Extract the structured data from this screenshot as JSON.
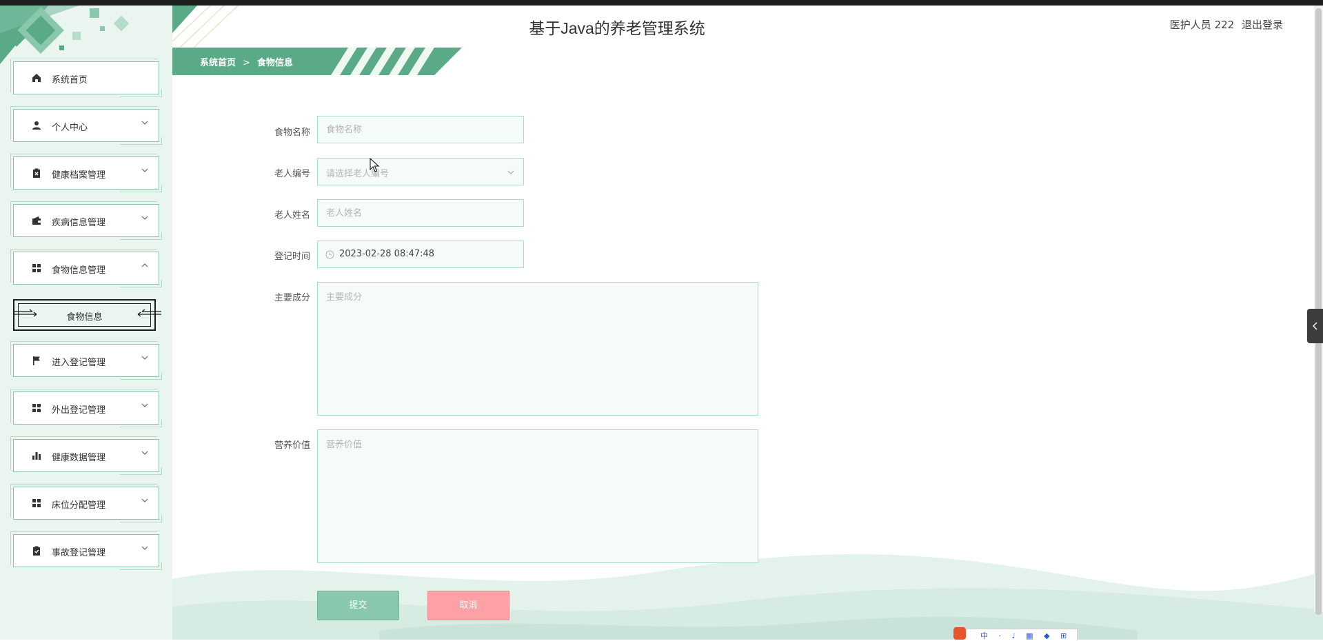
{
  "app": {
    "title": "基于Java的养老管理系统"
  },
  "user": {
    "role_name": "医护人员 222",
    "logout_label": "退出登录"
  },
  "breadcrumb": {
    "home": "系统首页",
    "separator": ">",
    "current": "食物信息"
  },
  "sidebar": {
    "items": [
      {
        "label": "系统首页",
        "icon": "home-icon"
      },
      {
        "label": "个人中心",
        "icon": "person-icon",
        "expandable": true
      },
      {
        "label": "健康档案管理",
        "icon": "clipboard-x-icon",
        "expandable": true
      },
      {
        "label": "疾病信息管理",
        "icon": "wallet-icon",
        "expandable": true
      },
      {
        "label": "食物信息管理",
        "icon": "grid-icon",
        "expandable": true,
        "expanded": true
      },
      {
        "label": "进入登记管理",
        "icon": "flag-icon",
        "expandable": true
      },
      {
        "label": "外出登记管理",
        "icon": "grid-icon",
        "expandable": true
      },
      {
        "label": "健康数据管理",
        "icon": "bar-chart-icon",
        "expandable": true
      },
      {
        "label": "床位分配管理",
        "icon": "grid-icon",
        "expandable": true
      },
      {
        "label": "事故登记管理",
        "icon": "clipboard-check-icon",
        "expandable": true
      }
    ],
    "sub_items": [
      {
        "label": "食物信息",
        "active": true
      }
    ]
  },
  "form": {
    "food_name": {
      "label": "食物名称",
      "placeholder": "食物名称",
      "value": ""
    },
    "elder_id": {
      "label": "老人编号",
      "placeholder": "请选择老人编号"
    },
    "elder_name": {
      "label": "老人姓名",
      "placeholder": "老人姓名",
      "value": ""
    },
    "register_time": {
      "label": "登记时间",
      "value": "2023-02-28 08:47:48"
    },
    "ingredients": {
      "label": "主要成分",
      "placeholder": "主要成分"
    },
    "nutrition": {
      "label": "营养价值",
      "placeholder": "营养价值"
    },
    "submit_label": "提交",
    "cancel_label": "取消"
  },
  "ime": {
    "text": "中 · ♩ ▦ ◆ ⊞"
  },
  "colors": {
    "accent": "#5aa987",
    "sidebar_bg": "#eaf5f0",
    "submit_bg": "#89c8ac",
    "cancel_bg": "#fda1a6"
  }
}
